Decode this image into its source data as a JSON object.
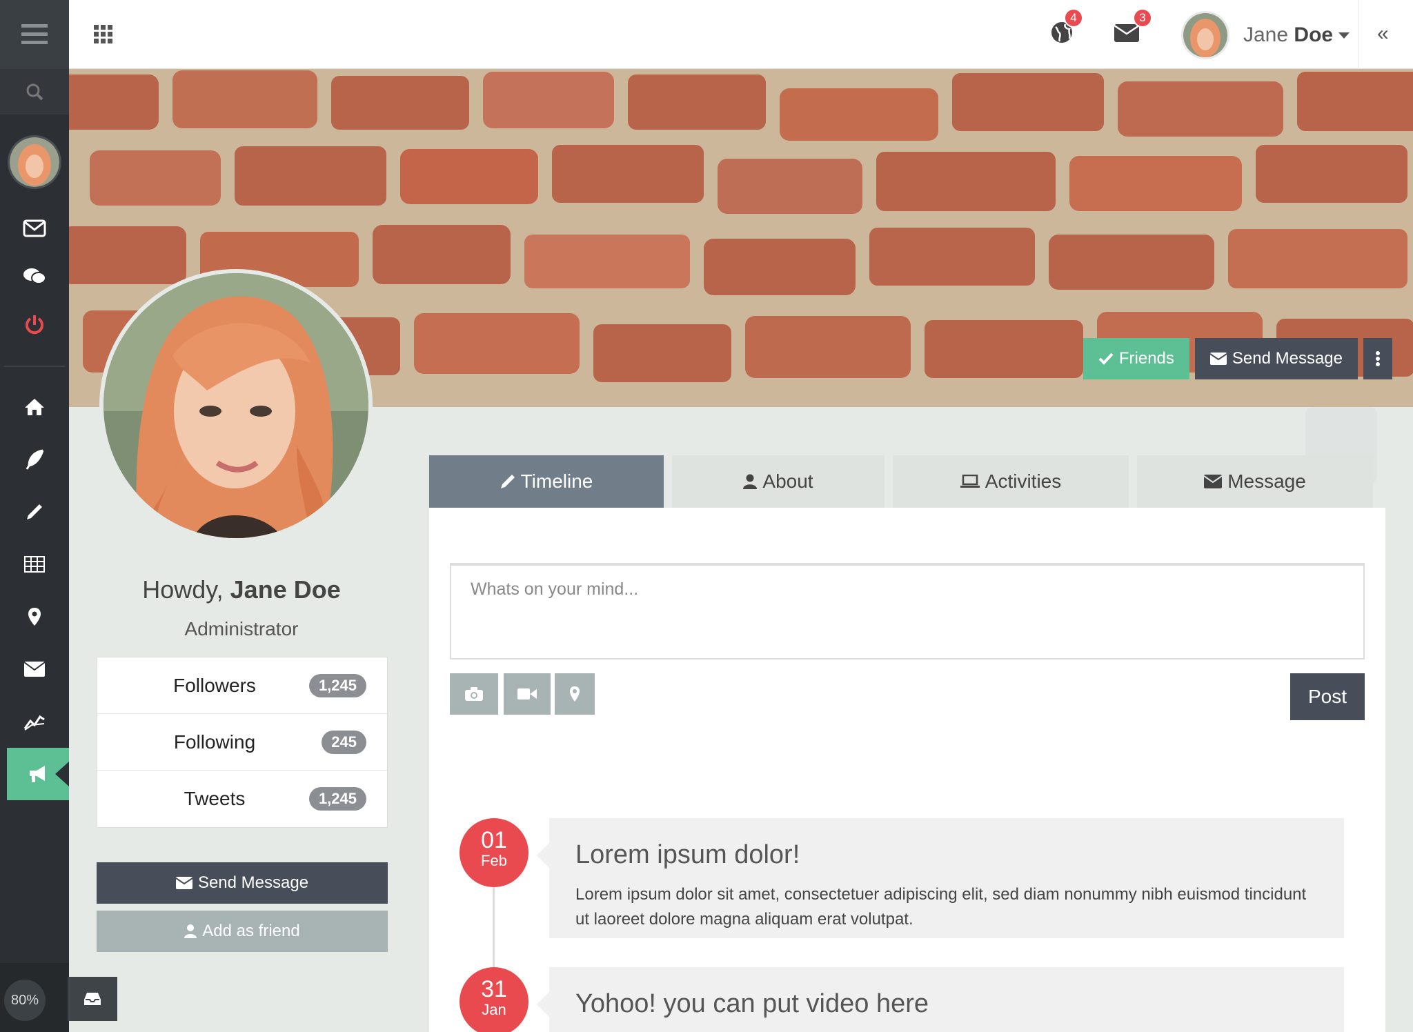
{
  "header": {
    "notifications_count": "4",
    "messages_count": "3",
    "user_name_first": "Jane",
    "user_name_last": "Doe",
    "collapse_glyph": "«"
  },
  "sidebar": {
    "zoom": "80%",
    "icons": [
      "menu-icon",
      "search-icon",
      "envelope-icon",
      "chat-icon",
      "power-icon",
      "home-icon",
      "feather-icon",
      "pencil-icon",
      "table-icon",
      "map-marker-icon",
      "envelope-icon",
      "chart-line-icon",
      "bullhorn-icon"
    ]
  },
  "cover": {
    "friends_label": "Friends",
    "send_message_label": "Send Message"
  },
  "profile": {
    "greeting": "Howdy,",
    "name": "Jane Doe",
    "role": "Administrator",
    "stats": [
      {
        "label": "Followers",
        "value": "1,245"
      },
      {
        "label": "Following",
        "value": "245"
      },
      {
        "label": "Tweets",
        "value": "1,245"
      }
    ],
    "send_message_label": "Send Message",
    "add_friend_label": "Add as friend"
  },
  "tabs": [
    {
      "label": "Timeline",
      "active": true
    },
    {
      "label": "About",
      "active": false
    },
    {
      "label": "Activities",
      "active": false
    },
    {
      "label": "Message",
      "active": false
    }
  ],
  "composer": {
    "placeholder": "Whats on your mind...",
    "post_label": "Post"
  },
  "timeline": [
    {
      "day": "01",
      "month": "Feb",
      "title": "Lorem ipsum dolor!",
      "body": "Lorem ipsum dolor sit amet, consectetuer adipiscing elit, sed diam nonummy nibh euismod tincidunt ut laoreet dolore magna aliquam erat volutpat."
    },
    {
      "day": "31",
      "month": "Jan",
      "title": "Yohoo! you can put video here",
      "body": ""
    }
  ],
  "colors": {
    "accent_green": "#5dbf94",
    "dark_button": "#474e5a",
    "danger_red": "#e84a4f",
    "sidebar_bg": "#2c3034"
  }
}
